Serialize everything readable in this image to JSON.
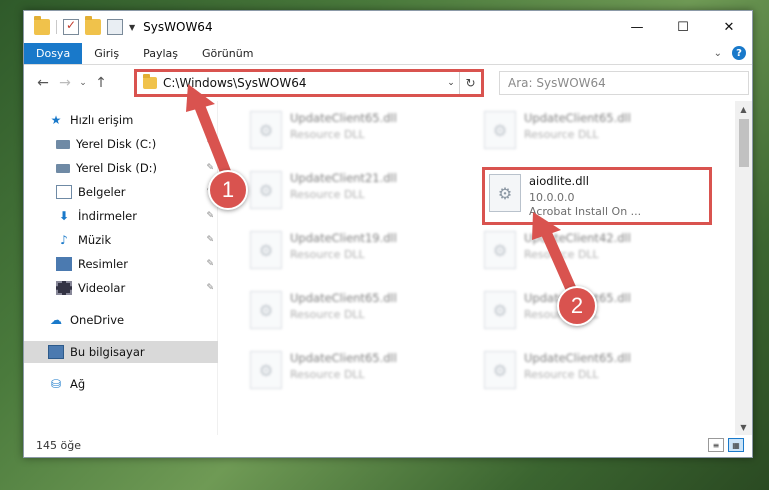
{
  "window": {
    "title": "SysWOW64",
    "minimize_glyph": "—",
    "maximize_glyph": "☐",
    "close_glyph": "✕"
  },
  "ribbon": {
    "tabs": [
      "Dosya",
      "Giriş",
      "Paylaş",
      "Görünüm"
    ],
    "active_tab": "Dosya",
    "help_glyph": "?",
    "expand_glyph": "⌄"
  },
  "nav": {
    "back_glyph": "←",
    "forward_glyph": "→",
    "recent_glyph": "⌄",
    "up_glyph": "↑"
  },
  "address": {
    "path": "C:\\Windows\\SysWOW64",
    "dropdown_glyph": "⌄",
    "refresh_glyph": "↻"
  },
  "search": {
    "placeholder": "Ara: SysWOW64"
  },
  "sidebar": {
    "items": [
      {
        "label": "Hızlı erişim",
        "icon": "star-icon"
      },
      {
        "label": "Yerel Disk (C:)",
        "icon": "drive-icon"
      },
      {
        "label": "Yerel Disk (D:)",
        "icon": "drive-icon"
      },
      {
        "label": "Belgeler",
        "icon": "documents-icon"
      },
      {
        "label": "İndirmeler",
        "icon": "download-icon"
      },
      {
        "label": "Müzik",
        "icon": "music-icon"
      },
      {
        "label": "Resimler",
        "icon": "pictures-icon"
      },
      {
        "label": "Videolar",
        "icon": "videos-icon"
      },
      {
        "label": "OneDrive",
        "icon": "cloud-icon"
      },
      {
        "label": "Bu bilgisayar",
        "icon": "computer-icon"
      },
      {
        "label": "Ağ",
        "icon": "network-icon"
      }
    ],
    "pin_glyph": "📌"
  },
  "files": [
    {
      "name": "UpdateClient65.dll",
      "desc": "Resource DLL"
    },
    {
      "name": "UpdateClient65.dll",
      "desc": "Resource DLL"
    },
    {
      "name": "UpdateClient21.dll",
      "desc": "Resource DLL"
    },
    {
      "name": "aiodlite.dll",
      "desc": "10.0.0.0",
      "desc2": "Acrobat Install On ..."
    },
    {
      "name": "UpdateClient19.dll",
      "desc": "Resource DLL"
    },
    {
      "name": "UpdateClient42.dll",
      "desc": "Resource DLL"
    },
    {
      "name": "UpdateClient65.dll",
      "desc": "Resource DLL"
    },
    {
      "name": "UpdateClient65.dll",
      "desc": "Resource DLL"
    },
    {
      "name": "UpdateClient65.dll",
      "desc": "Resource DLL"
    },
    {
      "name": "UpdateClient65.dll",
      "desc": "Resource DLL"
    }
  ],
  "status": {
    "count": "145 öğe"
  },
  "annotations": {
    "step1": "1",
    "step2": "2",
    "accent": "#d9534f"
  }
}
